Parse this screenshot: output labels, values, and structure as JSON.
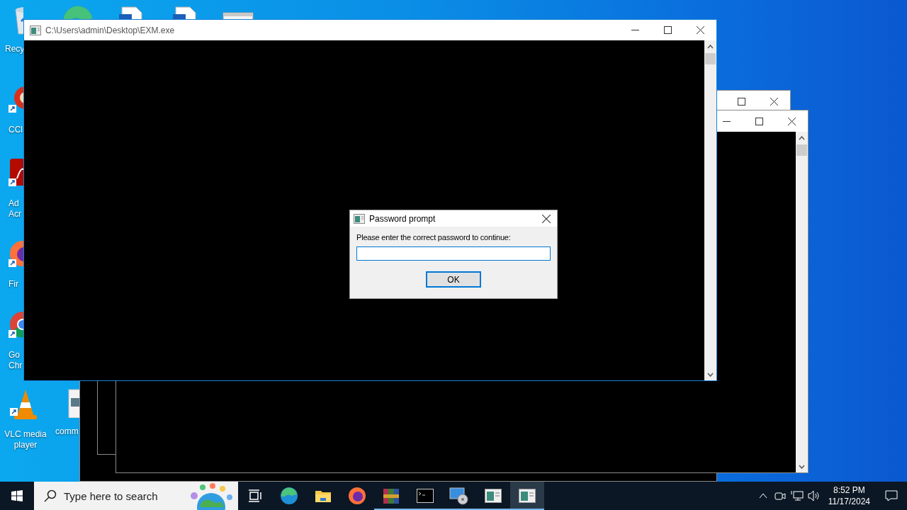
{
  "desktop_icons": [
    {
      "kind": "recycle-bin",
      "label": [
        "Recy"
      ]
    },
    {
      "kind": "edge"
    },
    {
      "kind": "document"
    },
    {
      "kind": "document"
    },
    {
      "kind": "app-window"
    },
    {
      "kind": "ccleaner",
      "label": [
        "CCl"
      ]
    },
    {
      "kind": "acrobat",
      "label": [
        "Ad",
        "Acr"
      ]
    },
    {
      "kind": "firefox",
      "label": [
        "Fir"
      ]
    },
    {
      "kind": "chrome",
      "label": [
        "Go",
        "Chr"
      ]
    },
    {
      "kind": "vlc",
      "label": [
        "VLC media",
        "player"
      ]
    },
    {
      "kind": "image-file",
      "label": [
        "comm"
      ]
    }
  ],
  "main_window": {
    "title": "C:\\Users\\admin\\Desktop\\EXM.exe"
  },
  "dialog": {
    "title": "Password prompt",
    "message": "Please enter the correct password to continue:",
    "button": "OK"
  },
  "taskbar": {
    "search": {
      "placeholder": "Type here to search"
    },
    "apps": [
      {
        "kind": "task-view",
        "running": false,
        "active": false
      },
      {
        "kind": "edge",
        "running": false,
        "active": false
      },
      {
        "kind": "explorer",
        "running": false,
        "active": false
      },
      {
        "kind": "firefox",
        "running": false,
        "active": false
      },
      {
        "kind": "winrar",
        "running": true,
        "active": false
      },
      {
        "kind": "console",
        "running": true,
        "active": false
      },
      {
        "kind": "settings-disc",
        "running": true,
        "active": false
      },
      {
        "kind": "app-window",
        "running": true,
        "active": false
      },
      {
        "kind": "app-window",
        "running": true,
        "active": true
      }
    ],
    "time": "8:52 PM",
    "date": "11/17/2024"
  }
}
